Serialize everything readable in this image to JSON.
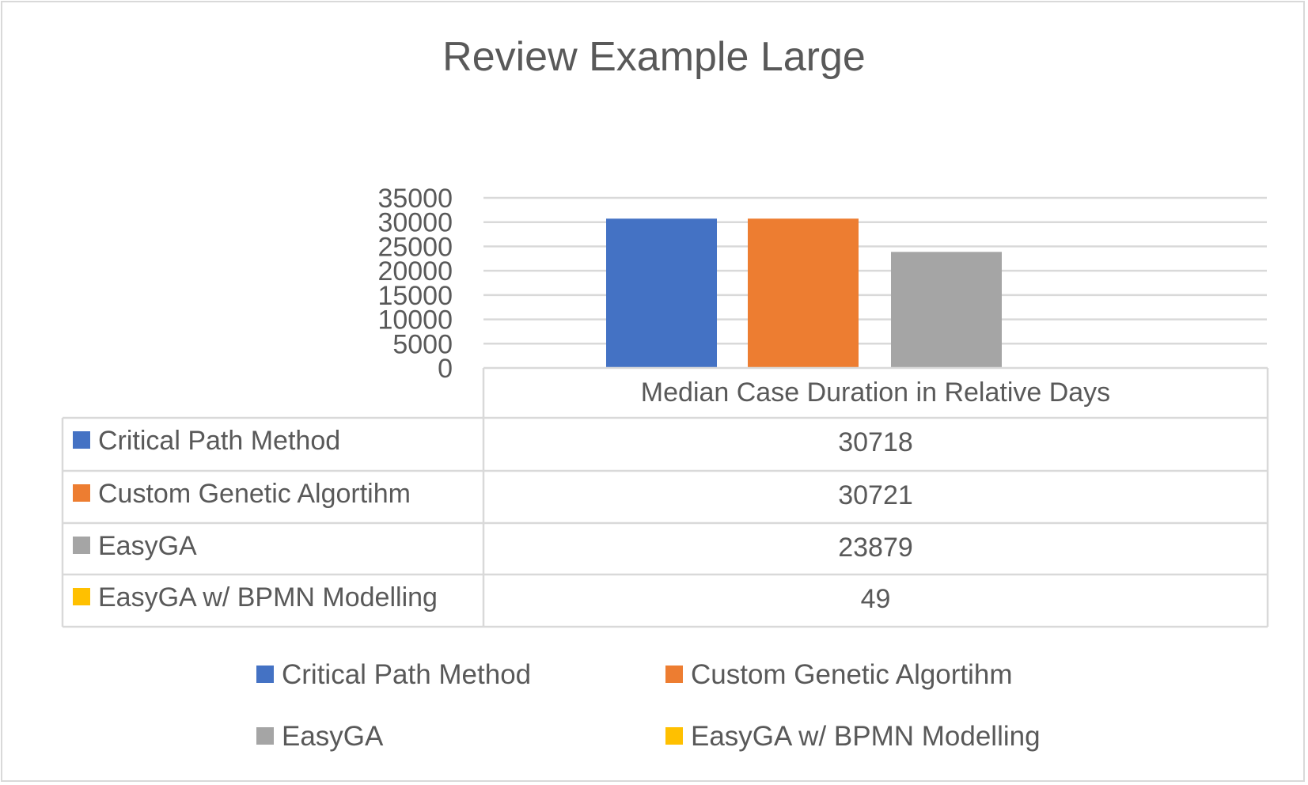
{
  "chart_data": {
    "type": "bar",
    "title": "Review Example Large",
    "categories": [
      "Median Case Duration in Relative Days"
    ],
    "series": [
      {
        "name": "Critical Path Method",
        "values": [
          30718
        ],
        "color": "#4472c4"
      },
      {
        "name": "Custom Genetic Algortihm",
        "values": [
          30721
        ],
        "color": "#ed7d31"
      },
      {
        "name": "EasyGA",
        "values": [
          23879
        ],
        "color": "#a5a5a5"
      },
      {
        "name": "EasyGA w/ BPMN Modelling",
        "values": [
          49
        ],
        "color": "#ffc000"
      }
    ],
    "ylim": [
      0,
      35000
    ],
    "yticks": [
      "0",
      "5000",
      "10000",
      "15000",
      "20000",
      "25000",
      "30000",
      "35000"
    ],
    "grid": true,
    "legend": "bottom",
    "data_table": true
  }
}
